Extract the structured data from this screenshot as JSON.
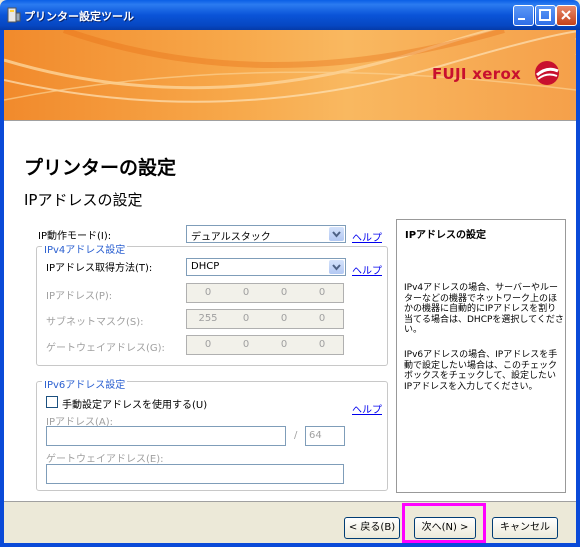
{
  "window": {
    "title": "プリンター設定ツール"
  },
  "banner": {
    "logo_text": "FUJI xerox",
    "brand_color": "#c8102e"
  },
  "page": {
    "heading": "プリンターの設定",
    "subheading": "IPアドレスの設定"
  },
  "form": {
    "ip_mode": {
      "label": "IP動作モード(I):",
      "value": "デュアルスタック",
      "help": "ヘルプ"
    },
    "ipv4": {
      "legend": "IPv4アドレス設定",
      "method": {
        "label": "IPアドレス取得方法(T):",
        "value": "DHCP",
        "help": "ヘルプ"
      },
      "ip_address": {
        "label": "IPアドレス(P):",
        "octets": [
          "0",
          "0",
          "0",
          "0"
        ]
      },
      "subnet_mask": {
        "label": "サブネットマスク(S):",
        "octets": [
          "255",
          "0",
          "0",
          "0"
        ]
      },
      "gateway": {
        "label": "ゲートウェイアドレス(G):",
        "octets": [
          "0",
          "0",
          "0",
          "0"
        ]
      }
    },
    "ipv6": {
      "legend": "IPv6アドレス設定",
      "manual_checkbox_label": "手動設定アドレスを使用する(U)",
      "help": "ヘルプ",
      "ip_address": {
        "label": "IPアドレス(A):",
        "value": "",
        "separator": "/",
        "prefix": "64"
      },
      "gateway": {
        "label": "ゲートウェイアドレス(E):",
        "value": ""
      }
    }
  },
  "help_panel": {
    "title": "IPアドレスの設定",
    "para1": "IPv4アドレスの場合、サーバーやルーターなどの機器でネットワーク上のほかの機器に自動的にIPアドレスを割り当てる場合は、DHCPを選択してください。",
    "para2": "IPv6アドレスの場合、IPアドレスを手動で設定したい場合は、このチェックボックスをチェックして、設定したいIPアドレスを入力してください。"
  },
  "buttons": {
    "back": "< 戻る(B)",
    "next": "次へ(N) >",
    "cancel": "キャンセル"
  },
  "colors": {
    "highlight": "#ff00ff",
    "titlebar": "#0a54d8",
    "link": "#0000ee"
  }
}
